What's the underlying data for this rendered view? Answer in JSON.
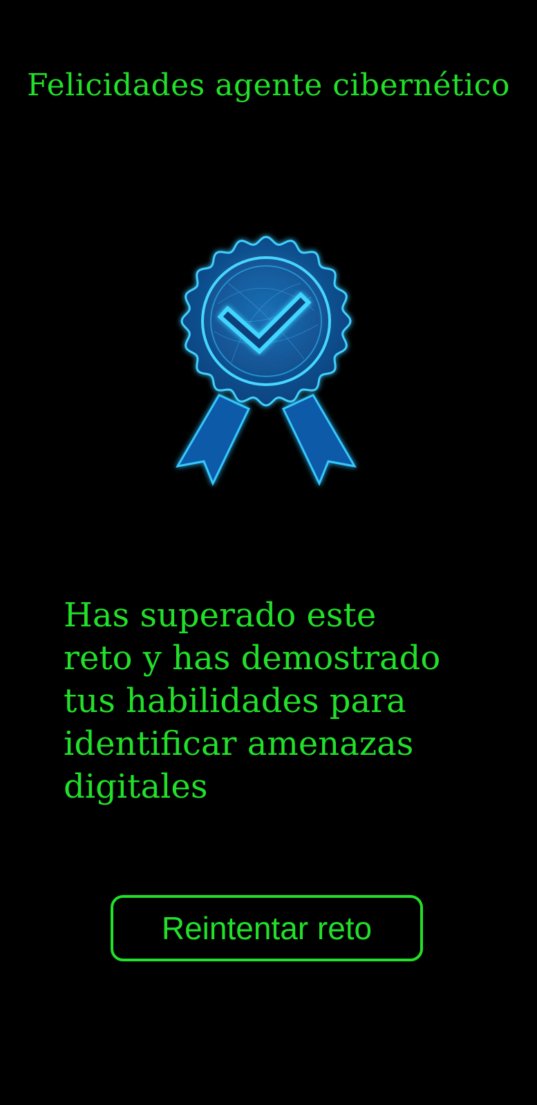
{
  "screen": {
    "background_color": "#000000",
    "accent_color": "#22e02a",
    "badge_color": "#1aa8ff"
  },
  "title": "Felicidades agente cibernético",
  "badge": {
    "icon": "award-ribbon-checkmark-icon"
  },
  "message": "Has superado este reto y has demostrado tus habilidades para identificar amenazas digitales",
  "retry_button": {
    "label": "Reintentar reto"
  }
}
